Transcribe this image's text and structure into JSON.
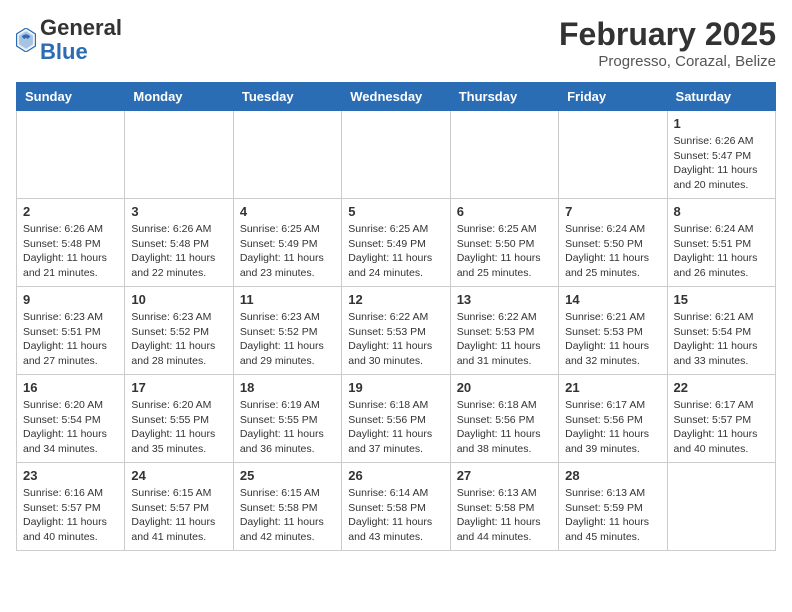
{
  "header": {
    "logo_general": "General",
    "logo_blue": "Blue",
    "month_title": "February 2025",
    "location": "Progresso, Corazal, Belize"
  },
  "days_of_week": [
    "Sunday",
    "Monday",
    "Tuesday",
    "Wednesday",
    "Thursday",
    "Friday",
    "Saturday"
  ],
  "weeks": [
    [
      {
        "day": "",
        "info": ""
      },
      {
        "day": "",
        "info": ""
      },
      {
        "day": "",
        "info": ""
      },
      {
        "day": "",
        "info": ""
      },
      {
        "day": "",
        "info": ""
      },
      {
        "day": "",
        "info": ""
      },
      {
        "day": "1",
        "info": "Sunrise: 6:26 AM\nSunset: 5:47 PM\nDaylight: 11 hours and 20 minutes."
      }
    ],
    [
      {
        "day": "2",
        "info": "Sunrise: 6:26 AM\nSunset: 5:48 PM\nDaylight: 11 hours and 21 minutes."
      },
      {
        "day": "3",
        "info": "Sunrise: 6:26 AM\nSunset: 5:48 PM\nDaylight: 11 hours and 22 minutes."
      },
      {
        "day": "4",
        "info": "Sunrise: 6:25 AM\nSunset: 5:49 PM\nDaylight: 11 hours and 23 minutes."
      },
      {
        "day": "5",
        "info": "Sunrise: 6:25 AM\nSunset: 5:49 PM\nDaylight: 11 hours and 24 minutes."
      },
      {
        "day": "6",
        "info": "Sunrise: 6:25 AM\nSunset: 5:50 PM\nDaylight: 11 hours and 25 minutes."
      },
      {
        "day": "7",
        "info": "Sunrise: 6:24 AM\nSunset: 5:50 PM\nDaylight: 11 hours and 25 minutes."
      },
      {
        "day": "8",
        "info": "Sunrise: 6:24 AM\nSunset: 5:51 PM\nDaylight: 11 hours and 26 minutes."
      }
    ],
    [
      {
        "day": "9",
        "info": "Sunrise: 6:23 AM\nSunset: 5:51 PM\nDaylight: 11 hours and 27 minutes."
      },
      {
        "day": "10",
        "info": "Sunrise: 6:23 AM\nSunset: 5:52 PM\nDaylight: 11 hours and 28 minutes."
      },
      {
        "day": "11",
        "info": "Sunrise: 6:23 AM\nSunset: 5:52 PM\nDaylight: 11 hours and 29 minutes."
      },
      {
        "day": "12",
        "info": "Sunrise: 6:22 AM\nSunset: 5:53 PM\nDaylight: 11 hours and 30 minutes."
      },
      {
        "day": "13",
        "info": "Sunrise: 6:22 AM\nSunset: 5:53 PM\nDaylight: 11 hours and 31 minutes."
      },
      {
        "day": "14",
        "info": "Sunrise: 6:21 AM\nSunset: 5:53 PM\nDaylight: 11 hours and 32 minutes."
      },
      {
        "day": "15",
        "info": "Sunrise: 6:21 AM\nSunset: 5:54 PM\nDaylight: 11 hours and 33 minutes."
      }
    ],
    [
      {
        "day": "16",
        "info": "Sunrise: 6:20 AM\nSunset: 5:54 PM\nDaylight: 11 hours and 34 minutes."
      },
      {
        "day": "17",
        "info": "Sunrise: 6:20 AM\nSunset: 5:55 PM\nDaylight: 11 hours and 35 minutes."
      },
      {
        "day": "18",
        "info": "Sunrise: 6:19 AM\nSunset: 5:55 PM\nDaylight: 11 hours and 36 minutes."
      },
      {
        "day": "19",
        "info": "Sunrise: 6:18 AM\nSunset: 5:56 PM\nDaylight: 11 hours and 37 minutes."
      },
      {
        "day": "20",
        "info": "Sunrise: 6:18 AM\nSunset: 5:56 PM\nDaylight: 11 hours and 38 minutes."
      },
      {
        "day": "21",
        "info": "Sunrise: 6:17 AM\nSunset: 5:56 PM\nDaylight: 11 hours and 39 minutes."
      },
      {
        "day": "22",
        "info": "Sunrise: 6:17 AM\nSunset: 5:57 PM\nDaylight: 11 hours and 40 minutes."
      }
    ],
    [
      {
        "day": "23",
        "info": "Sunrise: 6:16 AM\nSunset: 5:57 PM\nDaylight: 11 hours and 40 minutes."
      },
      {
        "day": "24",
        "info": "Sunrise: 6:15 AM\nSunset: 5:57 PM\nDaylight: 11 hours and 41 minutes."
      },
      {
        "day": "25",
        "info": "Sunrise: 6:15 AM\nSunset: 5:58 PM\nDaylight: 11 hours and 42 minutes."
      },
      {
        "day": "26",
        "info": "Sunrise: 6:14 AM\nSunset: 5:58 PM\nDaylight: 11 hours and 43 minutes."
      },
      {
        "day": "27",
        "info": "Sunrise: 6:13 AM\nSunset: 5:58 PM\nDaylight: 11 hours and 44 minutes."
      },
      {
        "day": "28",
        "info": "Sunrise: 6:13 AM\nSunset: 5:59 PM\nDaylight: 11 hours and 45 minutes."
      },
      {
        "day": "",
        "info": ""
      }
    ]
  ]
}
